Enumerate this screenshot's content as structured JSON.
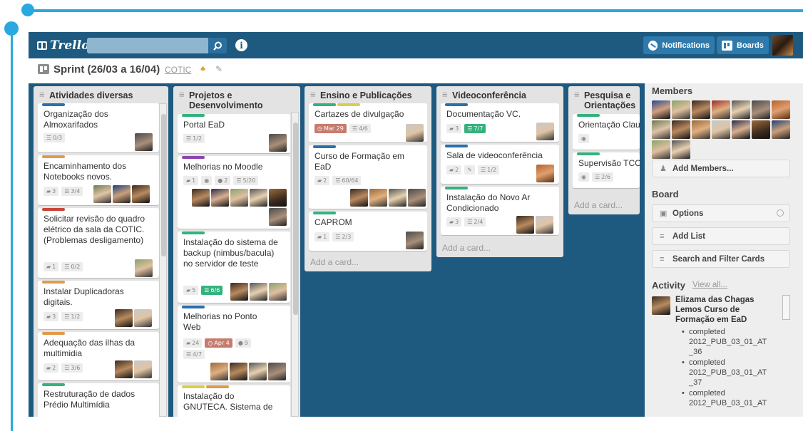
{
  "header": {
    "logo": "Trello",
    "search_placeholder": "",
    "notifications_label": "Notifications",
    "boards_label": "Boards"
  },
  "board": {
    "name": "Sprint (26/03 a 16/04)",
    "org": "COTIC"
  },
  "lists": [
    {
      "title": "Atividades diversas",
      "cards": [
        {
          "title": "Organização dos Almoxarifados",
          "badges": [
            "0/3"
          ]
        },
        {
          "title": "Encaminhamento dos Notebooks novos.",
          "badges": [
            "3",
            "3/4"
          ]
        },
        {
          "title": "Solicitar revisão do quadro elétrico da sala da COTIC. (Problemas desligamento)",
          "badges": [
            "1",
            "0/2"
          ]
        },
        {
          "title": "Instalar Duplicadoras digitais.",
          "badges": [
            "3",
            "1/2"
          ]
        },
        {
          "title": "Adequação das ilhas da multimidia",
          "badges": [
            "2",
            "3/6"
          ]
        },
        {
          "title": "Restruturação de dados Prédio Multimídia",
          "badges": []
        }
      ]
    },
    {
      "title": "Projetos e Desenvolvimento",
      "cards": [
        {
          "title": "Portal EaD",
          "badges": [
            "1/2"
          ]
        },
        {
          "title": "Melhorias no Moodle",
          "badges": [
            "1",
            "2",
            "5/20"
          ]
        },
        {
          "title": "Instalação do sistema de backup (nimbus/bacula) no servidor de teste",
          "badges": [
            "5",
            "6/6"
          ]
        },
        {
          "title": "Melhorias no Ponto Web",
          "badges": [
            "24",
            "Apr 4",
            "9",
            "4/7"
          ]
        },
        {
          "title": "Instalação do GNUTECA. Sistema de",
          "badges": []
        }
      ]
    },
    {
      "title": "Ensino e Publicações",
      "cards": [
        {
          "title": "Cartazes de divulgação",
          "badges": [
            "Mar 29",
            "4/6"
          ]
        },
        {
          "title": "Curso de Formação em EaD",
          "badges": [
            "2",
            "60/64"
          ]
        },
        {
          "title": "CAPROM",
          "badges": [
            "1",
            "2/3"
          ]
        }
      ],
      "add_card": "Add a card..."
    },
    {
      "title": "Videoconferência",
      "cards": [
        {
          "title": "Documentação VC.",
          "badges": [
            "3",
            "7/7"
          ]
        },
        {
          "title": "Sala de videoconferência",
          "badges": [
            "2",
            "1/2"
          ]
        },
        {
          "title": "Instalação do Novo Ar Condicionado",
          "badges": [
            "3",
            "2/4"
          ]
        }
      ],
      "add_card": "Add a card..."
    },
    {
      "title": "Pesquisa e Orientações",
      "cards": [
        {
          "title": "Orientação Clau",
          "badges": []
        },
        {
          "title": "Supervisão TCC",
          "badges": [
            "2/6"
          ]
        }
      ],
      "add_card": "Add a card..."
    }
  ],
  "sidebar": {
    "members_title": "Members",
    "add_members": "Add Members...",
    "board_title": "Board",
    "options": "Options",
    "add_list": "Add List",
    "search_filter": "Search and Filter Cards",
    "activity_title": "Activity",
    "view_all": "View all...",
    "activity_entry": "Elizama das Chagas Lemos Curso de Formação em EaD",
    "activity_items": [
      {
        "action": "completed",
        "item": "2012_PUB_03_01_AT",
        "suffix": "_36"
      },
      {
        "action": "completed",
        "item": "2012_PUB_03_01_AT",
        "suffix": "_37"
      },
      {
        "action": "completed",
        "item": "2012_PUB_03_01_AT",
        "suffix": ""
      }
    ]
  },
  "colors": {
    "header": "#1e5a80",
    "board_bg": "#1e5a80",
    "label_blue": "#2a6fb0",
    "label_orange": "#e09a4a",
    "label_red": "#c9453a",
    "label_green": "#34b27d",
    "label_yellow": "#d9cf4a",
    "label_purple": "#8e44ad"
  }
}
